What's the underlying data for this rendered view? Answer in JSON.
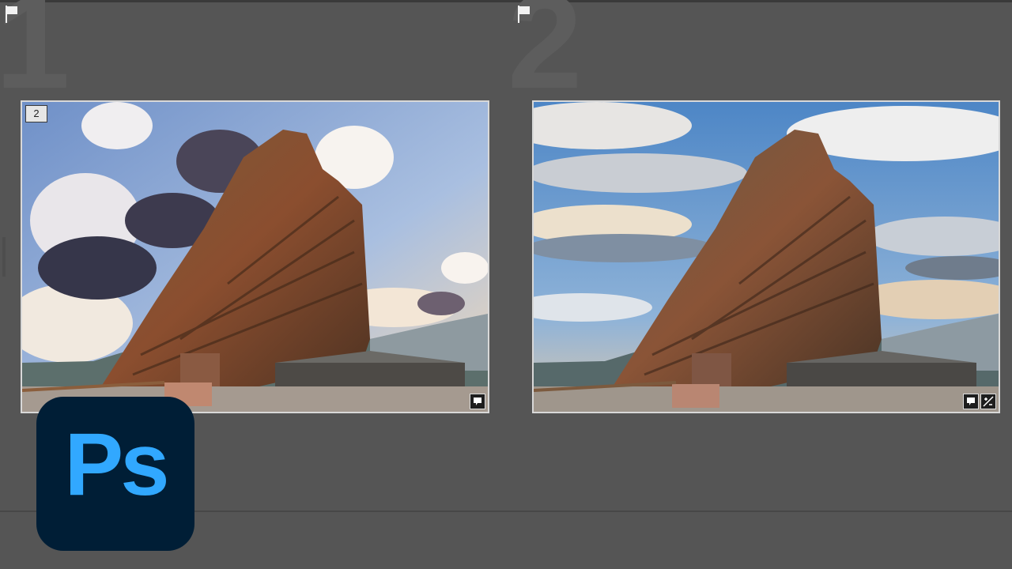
{
  "grid": {
    "cells": [
      {
        "number": "1",
        "count_badge": "2"
      },
      {
        "number": "2"
      }
    ]
  },
  "logo": {
    "text": "Ps"
  },
  "colors": {
    "background": "#555555",
    "ps_bg": "#001e36",
    "ps_text": "#31a8ff"
  },
  "icons": {
    "cell_flag": "flag-icon",
    "comment_badge": "comment-icon",
    "edited_badge": "edited-icon"
  }
}
